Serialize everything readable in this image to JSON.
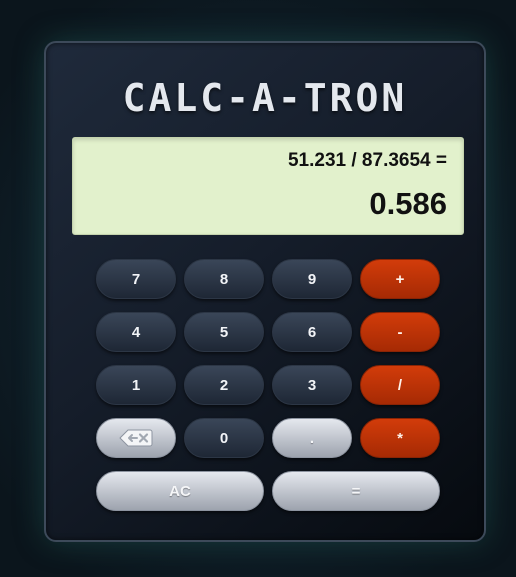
{
  "app": {
    "title": "CALC-A-TRON"
  },
  "display": {
    "expression": "51.231 / 87.3654 =",
    "result": "0.586"
  },
  "keys": {
    "seven": "7",
    "eight": "8",
    "nine": "9",
    "plus": "+",
    "four": "4",
    "five": "5",
    "six": "6",
    "minus": "-",
    "one": "1",
    "two": "2",
    "three": "3",
    "divide": "/",
    "backspace_icon": "backspace-icon",
    "zero": "0",
    "decimal": ".",
    "multiply": "*",
    "clear": "AC",
    "equals": "="
  },
  "colors": {
    "operator_accent": "#c63606",
    "display_background": "#e2f1cc",
    "number_key": "#2b3546",
    "light_key": "#c3c7cf"
  }
}
